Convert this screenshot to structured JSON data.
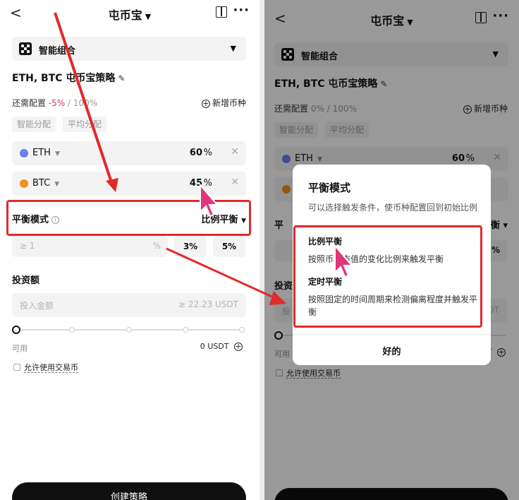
{
  "left": {
    "header": {
      "back": "<",
      "title": "屯币宝",
      "title_caret": "▼",
      "more": "···"
    },
    "portfolio": {
      "label": "智能组合",
      "caret": "▼"
    },
    "strategy_title": "ETH, BTC 屯币宝策略",
    "allocation": {
      "prefix": "还需配置",
      "remaining": "-5%",
      "total": "/ 100%"
    },
    "add_coin": "新增币种",
    "chips": [
      "智能分配",
      "平均分配"
    ],
    "coins": [
      {
        "name": "ETH",
        "value": "60",
        "unit": "%",
        "color": "#6a7ff0"
      },
      {
        "name": "BTC",
        "value": "45",
        "unit": "%",
        "color": "#f2921b"
      }
    ],
    "balance_mode": {
      "label": "平衡模式",
      "value": "比例平衡"
    },
    "threshold": {
      "placeholder": "≥ 1",
      "unit": "%",
      "options": [
        "3%",
        "5%"
      ]
    },
    "invest": {
      "label": "投资额",
      "placeholder": "投入金额",
      "minimum": "≥ 22.23 USDT"
    },
    "slider": {
      "value": 0
    },
    "available": {
      "label": "可用",
      "value": "0 USDT"
    },
    "allow_trading": "允许使用交易币",
    "create_button": "创建策略"
  },
  "right": {
    "header": {
      "back": "<",
      "title": "屯币宝",
      "title_caret": "▼",
      "more": "···"
    },
    "portfolio": {
      "label": "智能组合",
      "caret": "▼"
    },
    "strategy_title": "ETH, BTC 屯币宝策略",
    "allocation": {
      "prefix": "还需配置",
      "remaining": "0%",
      "total": "/ 100%"
    },
    "add_coin": "新增币种",
    "chips": [
      "智能分配",
      "平均分配"
    ],
    "coins": [
      {
        "name": "ETH",
        "value": "60",
        "unit": "%",
        "color": "#6a7ff0"
      }
    ],
    "bg_fragments": {
      "mode_label": "平",
      "mode_caret": "衡 ▾",
      "pct": "%",
      "invest_label": "投资",
      "invest_prefix": "投",
      "invest_suffix": "DT",
      "avail": "可用",
      "avail_suffix": "T"
    },
    "allow_trading": "允许使用交易币",
    "modal": {
      "title": "平衡模式",
      "description": "可以选择触发条件，使币种配置回到初始比例",
      "option1_title": "比例平衡",
      "option1_text": "按照币种市值的变化比例来触发平衡",
      "option2_title": "定时平衡",
      "option2_text": "按照固定的时间周期来检测偏离程度并触发平衡",
      "ok": "好的"
    }
  }
}
